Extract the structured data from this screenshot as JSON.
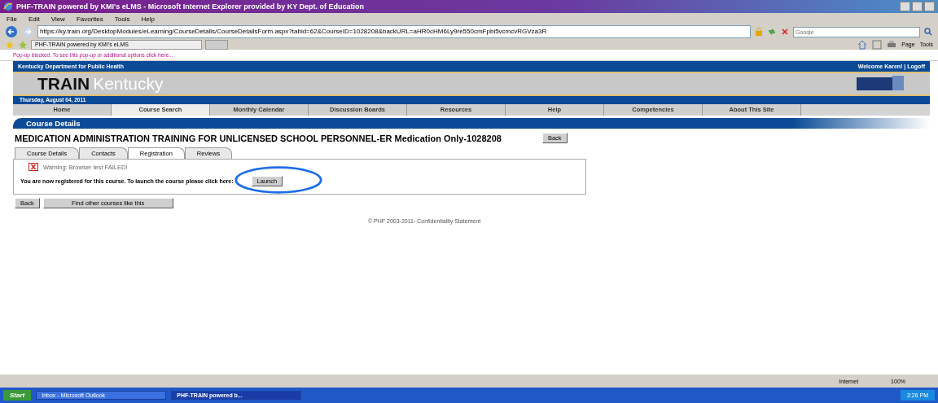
{
  "window": {
    "title": "PHF-TRAIN powered by KMI's eLMS - Microsoft Internet Explorer provided by KY Dept. of Education"
  },
  "menu": [
    "File",
    "Edit",
    "View",
    "Favorites",
    "Tools",
    "Help"
  ],
  "address": {
    "url": "https://ky.train.org/DesktopModules/eLearning/CourseDetails/CourseDetailsForm.aspx?tabid=62&CourseID=1028208&backURL=aHR0cHM6Ly9re550cmFpbi5vcmcvRGVza3R"
  },
  "search": {
    "placeholder": "Google"
  },
  "browser_tabs": [
    {
      "label": "PHF-TRAIN powered by KMI's eLMS",
      "selected": true
    }
  ],
  "command_bar": [
    "Page",
    "Tools"
  ],
  "popup_notice": "Pop-up blocked. To see this pop-up or additional options click here...",
  "site": {
    "org": "Kentucky Department for Public Health",
    "welcome": "Welcome Karen! | Logoff",
    "logo_bold": "TRAIN",
    "logo_light": "Kentucky",
    "date": "Thursday, August 04, 2011"
  },
  "nav": [
    {
      "label": "Home",
      "selected": false
    },
    {
      "label": "Course Search",
      "selected": true
    },
    {
      "label": "Monthly Calendar",
      "selected": false
    },
    {
      "label": "Discussion Boards",
      "selected": false
    },
    {
      "label": "Resources",
      "selected": false
    },
    {
      "label": "Help",
      "selected": false
    },
    {
      "label": "Competencies",
      "selected": false
    },
    {
      "label": "About This Site",
      "selected": false
    }
  ],
  "section_title": "Course Details",
  "course_title": "MEDICATION ADMINISTRATION TRAINING FOR UNLICENSED SCHOOL PERSONNEL-ER Medication Only-1028208",
  "back_top": "Back",
  "tabs": [
    {
      "label": "Course Details",
      "selected": false
    },
    {
      "label": "Contacts",
      "selected": false
    },
    {
      "label": "Registration",
      "selected": true
    },
    {
      "label": "Reviews",
      "selected": false
    }
  ],
  "warning": "Warning: Browser test FAILED!",
  "registered_text": "You are now registered for this course. To launch the course please click here:",
  "launch_button": "Launch",
  "bottom_buttons": [
    "Back",
    "Find other courses like this"
  ],
  "footer": "© PHF 2003-2011- Confidentiality Statement",
  "status_bar": {
    "zone": "Internet",
    "zoom": "100%"
  },
  "taskbar": {
    "start": "Start",
    "items": [
      {
        "label": "Inbox - Microsoft Outlook",
        "selected": false
      },
      {
        "label": "PHF-TRAIN powered b...",
        "selected": true
      }
    ],
    "clock": "2:26 PM"
  }
}
